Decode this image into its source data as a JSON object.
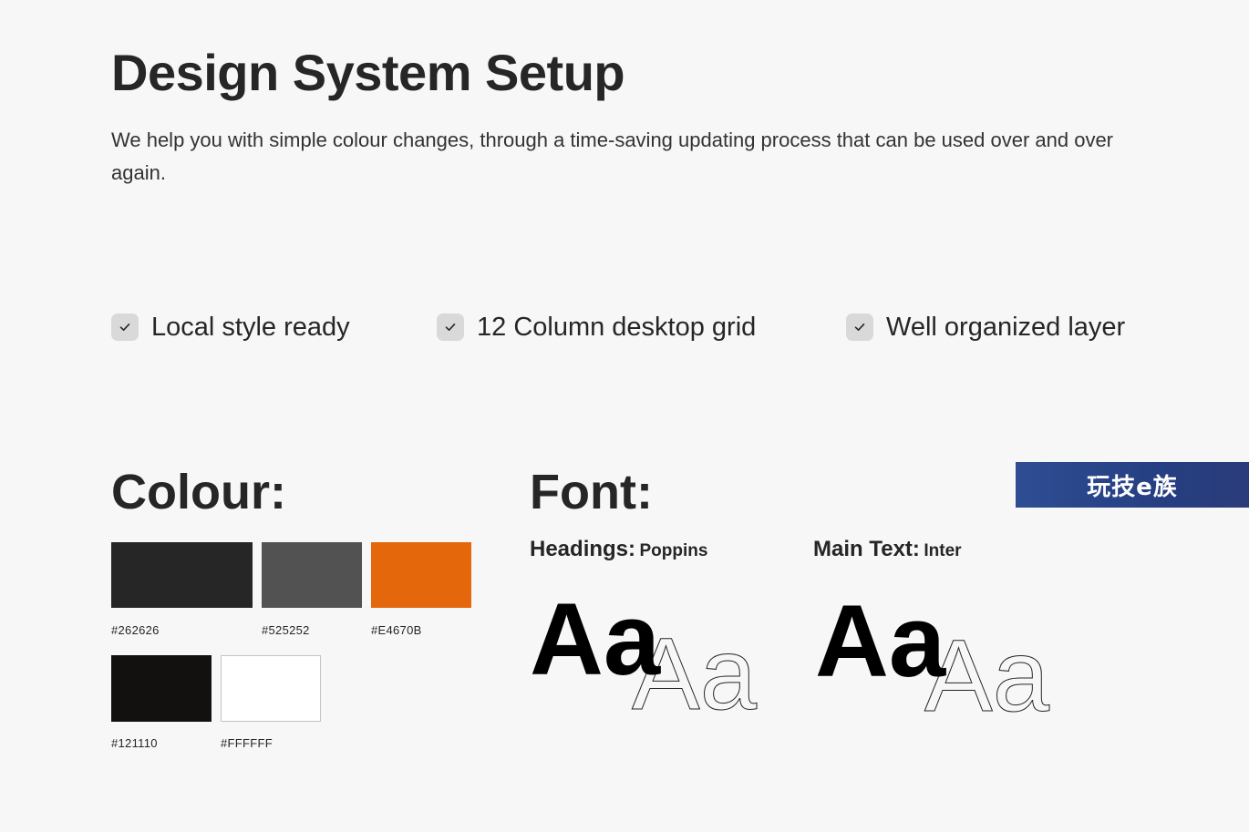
{
  "header": {
    "title": "Design System Setup",
    "description": "We help you with simple colour changes, through a time-saving updating process that can be used over and over again."
  },
  "features": [
    {
      "label": "Local style ready",
      "checked": true
    },
    {
      "label": "12 Column desktop grid",
      "checked": true
    },
    {
      "label": "Well organized layer",
      "checked": true
    }
  ],
  "colour": {
    "title": "Colour:",
    "swatches": [
      {
        "hex": "#262626",
        "label": "#262626"
      },
      {
        "hex": "#525252",
        "label": "#525252"
      },
      {
        "hex": "#E4670B",
        "label": "#E4670B"
      },
      {
        "hex": "#121110",
        "label": "#121110"
      },
      {
        "hex": "#FFFFFF",
        "label": "#FFFFFF"
      }
    ]
  },
  "font": {
    "title": "Font:",
    "headings": {
      "label": "Headings:",
      "family": "Poppins",
      "sample": "Aa"
    },
    "main_text": {
      "label": "Main Text:",
      "family": "Inter",
      "sample": "Aa"
    }
  },
  "watermark": {
    "text": "玩技e族"
  }
}
